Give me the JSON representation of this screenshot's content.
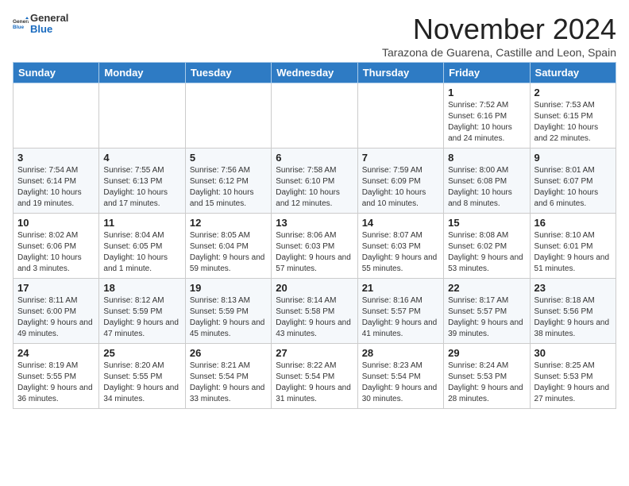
{
  "logo": {
    "general": "General",
    "blue": "Blue"
  },
  "title": "November 2024",
  "subtitle": "Tarazona de Guarena, Castille and Leon, Spain",
  "headers": [
    "Sunday",
    "Monday",
    "Tuesday",
    "Wednesday",
    "Thursday",
    "Friday",
    "Saturday"
  ],
  "weeks": [
    [
      {
        "day": "",
        "info": ""
      },
      {
        "day": "",
        "info": ""
      },
      {
        "day": "",
        "info": ""
      },
      {
        "day": "",
        "info": ""
      },
      {
        "day": "",
        "info": ""
      },
      {
        "day": "1",
        "info": "Sunrise: 7:52 AM\nSunset: 6:16 PM\nDaylight: 10 hours and 24 minutes."
      },
      {
        "day": "2",
        "info": "Sunrise: 7:53 AM\nSunset: 6:15 PM\nDaylight: 10 hours and 22 minutes."
      }
    ],
    [
      {
        "day": "3",
        "info": "Sunrise: 7:54 AM\nSunset: 6:14 PM\nDaylight: 10 hours and 19 minutes."
      },
      {
        "day": "4",
        "info": "Sunrise: 7:55 AM\nSunset: 6:13 PM\nDaylight: 10 hours and 17 minutes."
      },
      {
        "day": "5",
        "info": "Sunrise: 7:56 AM\nSunset: 6:12 PM\nDaylight: 10 hours and 15 minutes."
      },
      {
        "day": "6",
        "info": "Sunrise: 7:58 AM\nSunset: 6:10 PM\nDaylight: 10 hours and 12 minutes."
      },
      {
        "day": "7",
        "info": "Sunrise: 7:59 AM\nSunset: 6:09 PM\nDaylight: 10 hours and 10 minutes."
      },
      {
        "day": "8",
        "info": "Sunrise: 8:00 AM\nSunset: 6:08 PM\nDaylight: 10 hours and 8 minutes."
      },
      {
        "day": "9",
        "info": "Sunrise: 8:01 AM\nSunset: 6:07 PM\nDaylight: 10 hours and 6 minutes."
      }
    ],
    [
      {
        "day": "10",
        "info": "Sunrise: 8:02 AM\nSunset: 6:06 PM\nDaylight: 10 hours and 3 minutes."
      },
      {
        "day": "11",
        "info": "Sunrise: 8:04 AM\nSunset: 6:05 PM\nDaylight: 10 hours and 1 minute."
      },
      {
        "day": "12",
        "info": "Sunrise: 8:05 AM\nSunset: 6:04 PM\nDaylight: 9 hours and 59 minutes."
      },
      {
        "day": "13",
        "info": "Sunrise: 8:06 AM\nSunset: 6:03 PM\nDaylight: 9 hours and 57 minutes."
      },
      {
        "day": "14",
        "info": "Sunrise: 8:07 AM\nSunset: 6:03 PM\nDaylight: 9 hours and 55 minutes."
      },
      {
        "day": "15",
        "info": "Sunrise: 8:08 AM\nSunset: 6:02 PM\nDaylight: 9 hours and 53 minutes."
      },
      {
        "day": "16",
        "info": "Sunrise: 8:10 AM\nSunset: 6:01 PM\nDaylight: 9 hours and 51 minutes."
      }
    ],
    [
      {
        "day": "17",
        "info": "Sunrise: 8:11 AM\nSunset: 6:00 PM\nDaylight: 9 hours and 49 minutes."
      },
      {
        "day": "18",
        "info": "Sunrise: 8:12 AM\nSunset: 5:59 PM\nDaylight: 9 hours and 47 minutes."
      },
      {
        "day": "19",
        "info": "Sunrise: 8:13 AM\nSunset: 5:59 PM\nDaylight: 9 hours and 45 minutes."
      },
      {
        "day": "20",
        "info": "Sunrise: 8:14 AM\nSunset: 5:58 PM\nDaylight: 9 hours and 43 minutes."
      },
      {
        "day": "21",
        "info": "Sunrise: 8:16 AM\nSunset: 5:57 PM\nDaylight: 9 hours and 41 minutes."
      },
      {
        "day": "22",
        "info": "Sunrise: 8:17 AM\nSunset: 5:57 PM\nDaylight: 9 hours and 39 minutes."
      },
      {
        "day": "23",
        "info": "Sunrise: 8:18 AM\nSunset: 5:56 PM\nDaylight: 9 hours and 38 minutes."
      }
    ],
    [
      {
        "day": "24",
        "info": "Sunrise: 8:19 AM\nSunset: 5:55 PM\nDaylight: 9 hours and 36 minutes."
      },
      {
        "day": "25",
        "info": "Sunrise: 8:20 AM\nSunset: 5:55 PM\nDaylight: 9 hours and 34 minutes."
      },
      {
        "day": "26",
        "info": "Sunrise: 8:21 AM\nSunset: 5:54 PM\nDaylight: 9 hours and 33 minutes."
      },
      {
        "day": "27",
        "info": "Sunrise: 8:22 AM\nSunset: 5:54 PM\nDaylight: 9 hours and 31 minutes."
      },
      {
        "day": "28",
        "info": "Sunrise: 8:23 AM\nSunset: 5:54 PM\nDaylight: 9 hours and 30 minutes."
      },
      {
        "day": "29",
        "info": "Sunrise: 8:24 AM\nSunset: 5:53 PM\nDaylight: 9 hours and 28 minutes."
      },
      {
        "day": "30",
        "info": "Sunrise: 8:25 AM\nSunset: 5:53 PM\nDaylight: 9 hours and 27 minutes."
      }
    ]
  ]
}
